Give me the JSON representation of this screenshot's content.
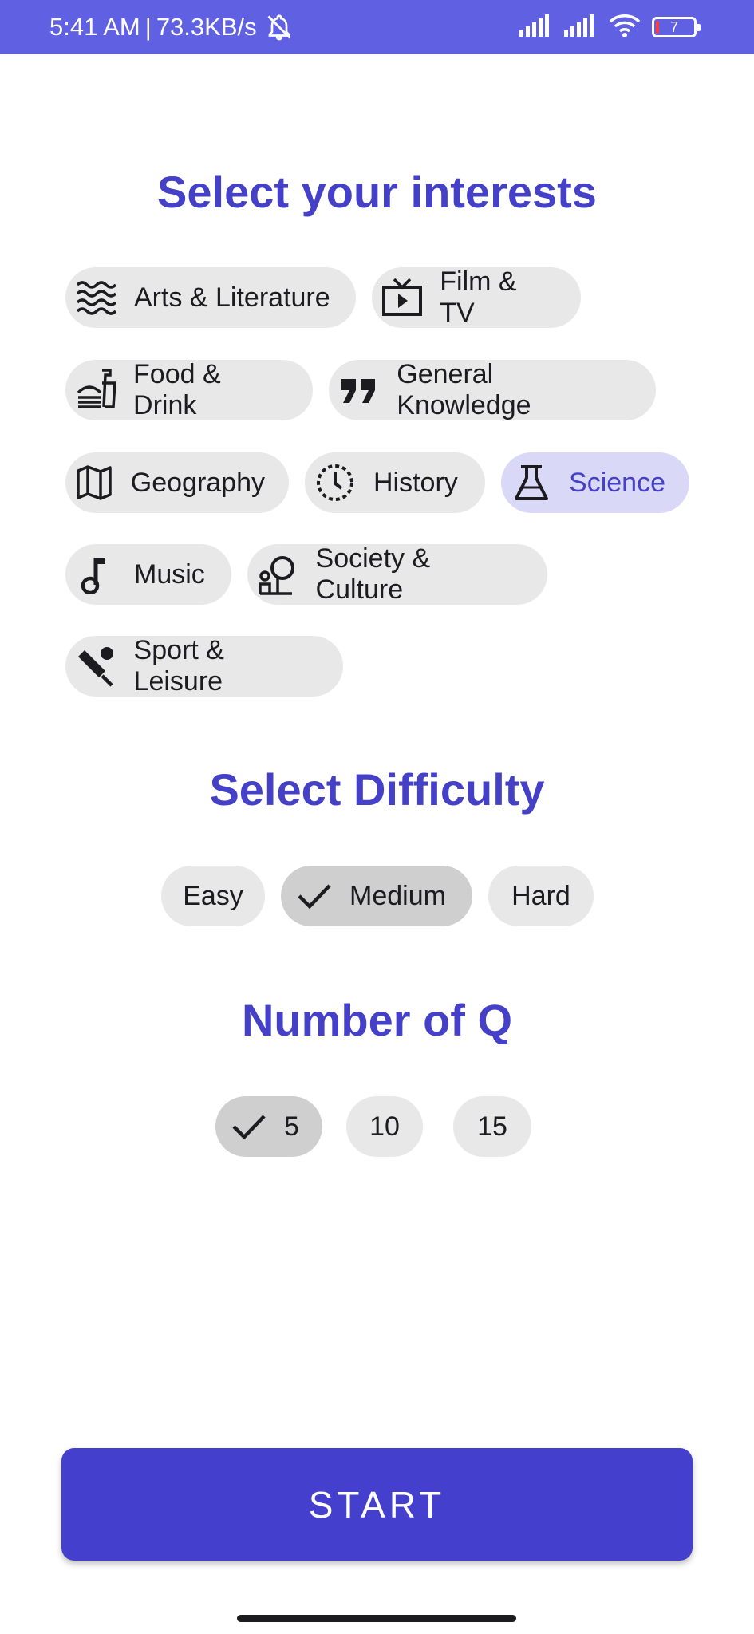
{
  "status_bar": {
    "time": "5:41 AM",
    "separator": "|",
    "speed": "73.3KB/s",
    "battery_level": "7",
    "icons": [
      "bell-off-icon",
      "signal-icon",
      "signal-icon",
      "wifi-icon",
      "battery-icon"
    ]
  },
  "interests": {
    "title": "Select your interests",
    "chips": [
      {
        "label": "Arts & Literature",
        "icon": "waves-icon",
        "selected": false
      },
      {
        "label": "Film & TV",
        "icon": "tv-icon",
        "selected": false
      },
      {
        "label": "Food & Drink",
        "icon": "fastfood-icon",
        "selected": false
      },
      {
        "label": "General Knowledge",
        "icon": "quote-icon",
        "selected": false
      },
      {
        "label": "Geography",
        "icon": "map-icon",
        "selected": false
      },
      {
        "label": "History",
        "icon": "history-clock-icon",
        "selected": false
      },
      {
        "label": "Science",
        "icon": "flask-icon",
        "selected": true
      },
      {
        "label": "Music",
        "icon": "music-note-icon",
        "selected": false
      },
      {
        "label": "Society & Culture",
        "icon": "society-icon",
        "selected": false
      },
      {
        "label": "Sport & Leisure",
        "icon": "cricket-icon",
        "selected": false
      }
    ]
  },
  "difficulty": {
    "title": "Select Difficulty",
    "options": [
      {
        "label": "Easy",
        "selected": false
      },
      {
        "label": "Medium",
        "selected": true
      },
      {
        "label": "Hard",
        "selected": false
      }
    ]
  },
  "questions": {
    "title": "Number of Q",
    "options": [
      {
        "label": "5",
        "selected": true
      },
      {
        "label": "10",
        "selected": false
      },
      {
        "label": "15",
        "selected": false
      }
    ]
  },
  "start_label": "START",
  "colors": {
    "accent": "#4440c8",
    "status_bar": "#6060e3",
    "chip_bg": "#e8e8e8",
    "chip_selected_accent": "#d9d9f7",
    "chip_selected_grey": "#cfcfcf",
    "button": "#4440cd"
  }
}
